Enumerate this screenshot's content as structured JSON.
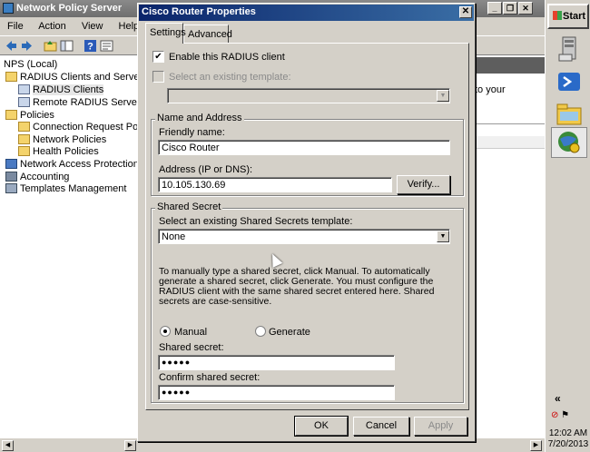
{
  "bg_window": {
    "title": "Network Policy Server",
    "menu": [
      "File",
      "Action",
      "View",
      "Help"
    ],
    "tree": [
      {
        "label": "NPS (Local)",
        "indent": 0,
        "icon": "server-icon"
      },
      {
        "label": "RADIUS Clients and Servers",
        "indent": 1,
        "icon": "folder-icon"
      },
      {
        "label": "RADIUS Clients",
        "indent": 2,
        "icon": "client-icon",
        "selected": true
      },
      {
        "label": "Remote RADIUS Server Group",
        "indent": 2,
        "icon": "server-group-icon"
      },
      {
        "label": "Policies",
        "indent": 1,
        "icon": "folder-icon"
      },
      {
        "label": "Connection Request Policies",
        "indent": 2,
        "icon": "folder-icon"
      },
      {
        "label": "Network Policies",
        "indent": 2,
        "icon": "folder-icon"
      },
      {
        "label": "Health Policies",
        "indent": 2,
        "icon": "folder-icon"
      },
      {
        "label": "Network Access Protection",
        "indent": 1,
        "icon": "nap-icon"
      },
      {
        "label": "Accounting",
        "indent": 1,
        "icon": "accounting-icon"
      },
      {
        "label": "Templates Management",
        "indent": 1,
        "icon": "templates-icon"
      }
    ],
    "right_pane_text": "to your"
  },
  "taskbar": {
    "start_label": "Start",
    "tray_chevron": "«",
    "time": "12:02 AM",
    "date": "7/20/2013"
  },
  "dialog": {
    "title": "Cisco Router Properties",
    "tabs": [
      "Settings",
      "Advanced"
    ],
    "active_tab": "Settings",
    "enable_label": "Enable this RADIUS client",
    "enable_checked": true,
    "select_template_label": "Select an existing template:",
    "select_template_checked": false,
    "template_value": "",
    "name_group": {
      "title": "Name and Address",
      "friendly_label": "Friendly name:",
      "friendly_value": "Cisco Router",
      "address_label": "Address (IP or DNS):",
      "address_value": "10.105.130.69",
      "verify_label": "Verify..."
    },
    "secret_group": {
      "title": "Shared Secret",
      "select_label": "Select an existing Shared Secrets template:",
      "select_value": "None",
      "info": "To manually type a shared secret, click Manual. To automatically generate a shared secret, click Generate. You must configure the RADIUS client with the same shared secret entered here. Shared secrets are case-sensitive.",
      "manual_label": "Manual",
      "generate_label": "Generate",
      "selected_mode": "Manual",
      "secret_label": "Shared secret:",
      "secret_value": "●●●●●",
      "confirm_label": "Confirm shared secret:",
      "confirm_value": "●●●●●"
    },
    "buttons": {
      "ok": "OK",
      "cancel": "Cancel",
      "apply": "Apply"
    }
  }
}
